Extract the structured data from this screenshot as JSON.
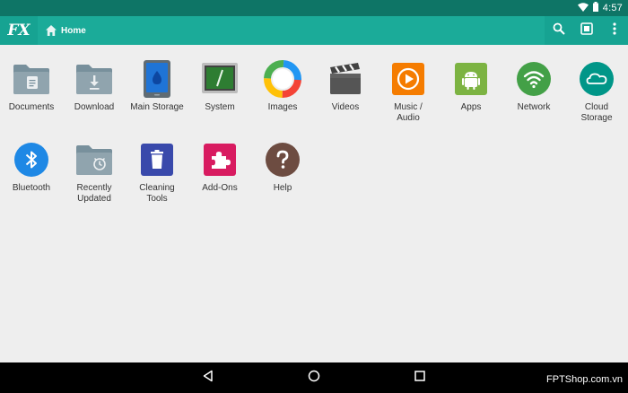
{
  "status": {
    "time": "4:57"
  },
  "toolbar": {
    "logo": "FX",
    "breadcrumb": "Home"
  },
  "items": [
    {
      "label": "Documents",
      "icon": "documents-folder-icon"
    },
    {
      "label": "Download",
      "icon": "download-folder-icon"
    },
    {
      "label": "Main Storage",
      "icon": "main-storage-icon"
    },
    {
      "label": "System",
      "icon": "system-terminal-icon"
    },
    {
      "label": "Images",
      "icon": "images-icon"
    },
    {
      "label": "Videos",
      "icon": "videos-clapper-icon"
    },
    {
      "label": "Music /\nAudio",
      "icon": "music-audio-icon"
    },
    {
      "label": "Apps",
      "icon": "android-apps-icon"
    },
    {
      "label": "Network",
      "icon": "network-wifi-icon"
    },
    {
      "label": "Cloud\nStorage",
      "icon": "cloud-storage-icon"
    },
    {
      "label": "Bluetooth",
      "icon": "bluetooth-icon"
    },
    {
      "label": "Recently\nUpdated",
      "icon": "recently-updated-folder-icon"
    },
    {
      "label": "Cleaning\nTools",
      "icon": "cleaning-tools-icon"
    },
    {
      "label": "Add-Ons",
      "icon": "add-ons-puzzle-icon"
    },
    {
      "label": "Help",
      "icon": "help-icon"
    }
  ],
  "watermark": "FPTShop.com.vn"
}
